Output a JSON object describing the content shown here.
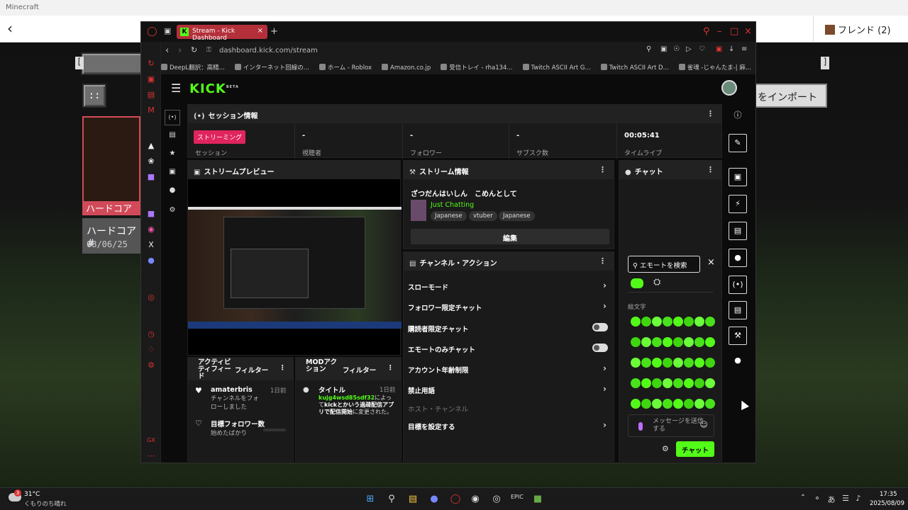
{
  "minecraft": {
    "window_title": "Minecraft",
    "friends_label": "フレンド (2)",
    "import_label": "をインポート",
    "hardcore_badge": "ハードコア",
    "world_title": "ハードコア#",
    "world_date": "08/06/25",
    "left_bracket": "[",
    "right_bracket": "]",
    "grid_icon": "::"
  },
  "browser": {
    "tab_title": "Stream - Kick Dashboard",
    "tab_icon": "K",
    "url": "dashboard.kick.com/stream",
    "bookmarks": [
      "DeepL翻訳：高精...",
      "インターネット回線の...",
      "ホーム - Roblox",
      "Amazon.co.jp",
      "受信トレイ - rha134...",
      "Twitch ASCII Art G...",
      "Twitch ASCII Art D...",
      "雀魂 -じゃんたま-| 麻..."
    ]
  },
  "kick": {
    "logo": "KICK",
    "logo_beta": "BETA",
    "session": {
      "header": "セッション情報",
      "badge": "ストリーミング",
      "stats": [
        {
          "value": "",
          "label": "セッション"
        },
        {
          "value": "-",
          "label": "視聴者"
        },
        {
          "value": "-",
          "label": "フォロワー"
        },
        {
          "value": "-",
          "label": "サブスク数"
        },
        {
          "value": "00:05:41",
          "label": "タイムライブ"
        }
      ]
    },
    "preview": {
      "header": "ストリームプレビュー"
    },
    "info": {
      "header": "ストリーム情報",
      "title": "ざつだんはいしん　こめんとして",
      "category": "Just Chatting",
      "tags": [
        "Japanese",
        "vtuber",
        "Japanese"
      ],
      "edit_label": "編集"
    },
    "actions": {
      "header": "チャンネル・アクション",
      "items": [
        {
          "label": "スローモード"
        },
        {
          "label": "フォロワー限定チャット"
        },
        {
          "label": "購読者限定チャット"
        },
        {
          "label": "エモートのみチャット"
        },
        {
          "label": "アカウント年齢制限"
        },
        {
          "label": "禁止用語"
        },
        {
          "label": "ホスト・チャンネル"
        },
        {
          "label": "目標を設定する"
        }
      ]
    },
    "activity": {
      "header": "アクティビティフィード",
      "filter": "フィルター",
      "items": [
        {
          "name": "amaterbris",
          "text": "チャンネルをフォローしました",
          "date": "1日前"
        },
        {
          "name": "目標フォロワー数",
          "text": "始めたばかり",
          "date": ""
        }
      ]
    },
    "mod": {
      "header": "MODアクション",
      "filter": "フィルター",
      "item_title": "タイトル",
      "item_date": "1日前",
      "item_user": "kujg4wsd85sdf32",
      "item_text_1": "によって",
      "item_text_2": "kickとかいう過疎配信アプリで配信開始",
      "item_text_3": "に変更された。"
    },
    "chat": {
      "header": "チャット",
      "search_placeholder": "エモートを検索",
      "emote_label": "絵文字",
      "message_placeholder": "メッセージを送信する",
      "send_label": "チャット"
    }
  },
  "taskbar": {
    "weather_badge": "3",
    "temperature": "31°C",
    "weather": "くもりのち晴れ",
    "time": "17:35",
    "date": "2025/08/09"
  },
  "colors": {
    "kick_green": "#53fc18",
    "streaming_badge": "#e0245e",
    "opera_red": "#dd3333"
  }
}
